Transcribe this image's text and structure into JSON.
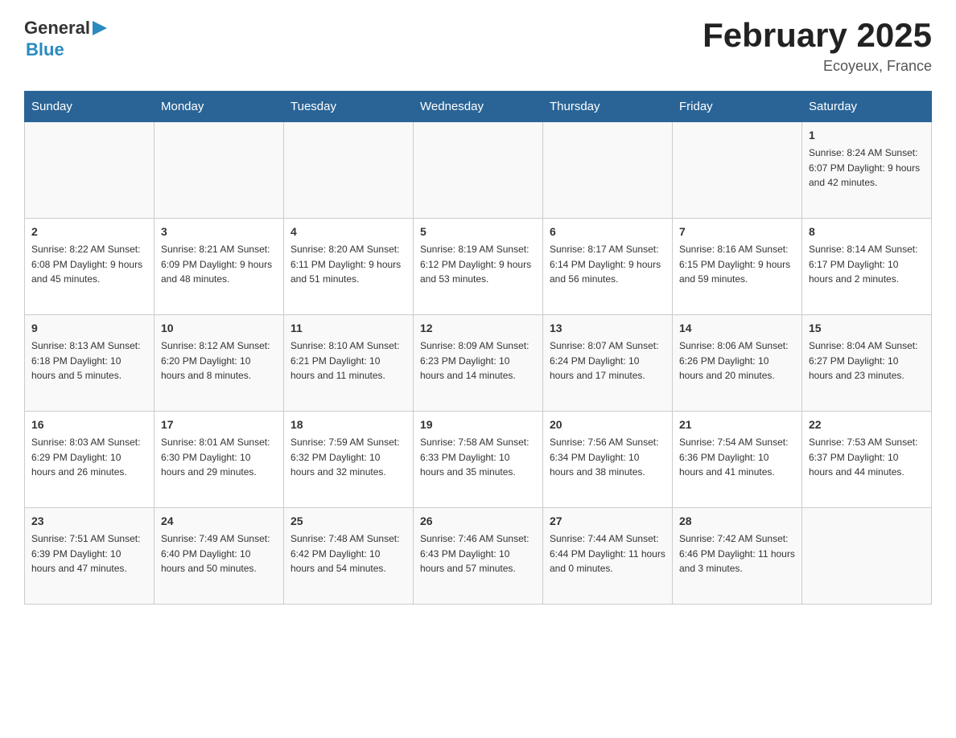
{
  "header": {
    "logo_general": "General",
    "logo_blue": "Blue",
    "title": "February 2025",
    "subtitle": "Ecoyeux, France"
  },
  "days_of_week": [
    "Sunday",
    "Monday",
    "Tuesday",
    "Wednesday",
    "Thursday",
    "Friday",
    "Saturday"
  ],
  "weeks": [
    [
      {
        "day": "",
        "info": ""
      },
      {
        "day": "",
        "info": ""
      },
      {
        "day": "",
        "info": ""
      },
      {
        "day": "",
        "info": ""
      },
      {
        "day": "",
        "info": ""
      },
      {
        "day": "",
        "info": ""
      },
      {
        "day": "1",
        "info": "Sunrise: 8:24 AM\nSunset: 6:07 PM\nDaylight: 9 hours and 42 minutes."
      }
    ],
    [
      {
        "day": "2",
        "info": "Sunrise: 8:22 AM\nSunset: 6:08 PM\nDaylight: 9 hours and 45 minutes."
      },
      {
        "day": "3",
        "info": "Sunrise: 8:21 AM\nSunset: 6:09 PM\nDaylight: 9 hours and 48 minutes."
      },
      {
        "day": "4",
        "info": "Sunrise: 8:20 AM\nSunset: 6:11 PM\nDaylight: 9 hours and 51 minutes."
      },
      {
        "day": "5",
        "info": "Sunrise: 8:19 AM\nSunset: 6:12 PM\nDaylight: 9 hours and 53 minutes."
      },
      {
        "day": "6",
        "info": "Sunrise: 8:17 AM\nSunset: 6:14 PM\nDaylight: 9 hours and 56 minutes."
      },
      {
        "day": "7",
        "info": "Sunrise: 8:16 AM\nSunset: 6:15 PM\nDaylight: 9 hours and 59 minutes."
      },
      {
        "day": "8",
        "info": "Sunrise: 8:14 AM\nSunset: 6:17 PM\nDaylight: 10 hours and 2 minutes."
      }
    ],
    [
      {
        "day": "9",
        "info": "Sunrise: 8:13 AM\nSunset: 6:18 PM\nDaylight: 10 hours and 5 minutes."
      },
      {
        "day": "10",
        "info": "Sunrise: 8:12 AM\nSunset: 6:20 PM\nDaylight: 10 hours and 8 minutes."
      },
      {
        "day": "11",
        "info": "Sunrise: 8:10 AM\nSunset: 6:21 PM\nDaylight: 10 hours and 11 minutes."
      },
      {
        "day": "12",
        "info": "Sunrise: 8:09 AM\nSunset: 6:23 PM\nDaylight: 10 hours and 14 minutes."
      },
      {
        "day": "13",
        "info": "Sunrise: 8:07 AM\nSunset: 6:24 PM\nDaylight: 10 hours and 17 minutes."
      },
      {
        "day": "14",
        "info": "Sunrise: 8:06 AM\nSunset: 6:26 PM\nDaylight: 10 hours and 20 minutes."
      },
      {
        "day": "15",
        "info": "Sunrise: 8:04 AM\nSunset: 6:27 PM\nDaylight: 10 hours and 23 minutes."
      }
    ],
    [
      {
        "day": "16",
        "info": "Sunrise: 8:03 AM\nSunset: 6:29 PM\nDaylight: 10 hours and 26 minutes."
      },
      {
        "day": "17",
        "info": "Sunrise: 8:01 AM\nSunset: 6:30 PM\nDaylight: 10 hours and 29 minutes."
      },
      {
        "day": "18",
        "info": "Sunrise: 7:59 AM\nSunset: 6:32 PM\nDaylight: 10 hours and 32 minutes."
      },
      {
        "day": "19",
        "info": "Sunrise: 7:58 AM\nSunset: 6:33 PM\nDaylight: 10 hours and 35 minutes."
      },
      {
        "day": "20",
        "info": "Sunrise: 7:56 AM\nSunset: 6:34 PM\nDaylight: 10 hours and 38 minutes."
      },
      {
        "day": "21",
        "info": "Sunrise: 7:54 AM\nSunset: 6:36 PM\nDaylight: 10 hours and 41 minutes."
      },
      {
        "day": "22",
        "info": "Sunrise: 7:53 AM\nSunset: 6:37 PM\nDaylight: 10 hours and 44 minutes."
      }
    ],
    [
      {
        "day": "23",
        "info": "Sunrise: 7:51 AM\nSunset: 6:39 PM\nDaylight: 10 hours and 47 minutes."
      },
      {
        "day": "24",
        "info": "Sunrise: 7:49 AM\nSunset: 6:40 PM\nDaylight: 10 hours and 50 minutes."
      },
      {
        "day": "25",
        "info": "Sunrise: 7:48 AM\nSunset: 6:42 PM\nDaylight: 10 hours and 54 minutes."
      },
      {
        "day": "26",
        "info": "Sunrise: 7:46 AM\nSunset: 6:43 PM\nDaylight: 10 hours and 57 minutes."
      },
      {
        "day": "27",
        "info": "Sunrise: 7:44 AM\nSunset: 6:44 PM\nDaylight: 11 hours and 0 minutes."
      },
      {
        "day": "28",
        "info": "Sunrise: 7:42 AM\nSunset: 6:46 PM\nDaylight: 11 hours and 3 minutes."
      },
      {
        "day": "",
        "info": ""
      }
    ]
  ]
}
